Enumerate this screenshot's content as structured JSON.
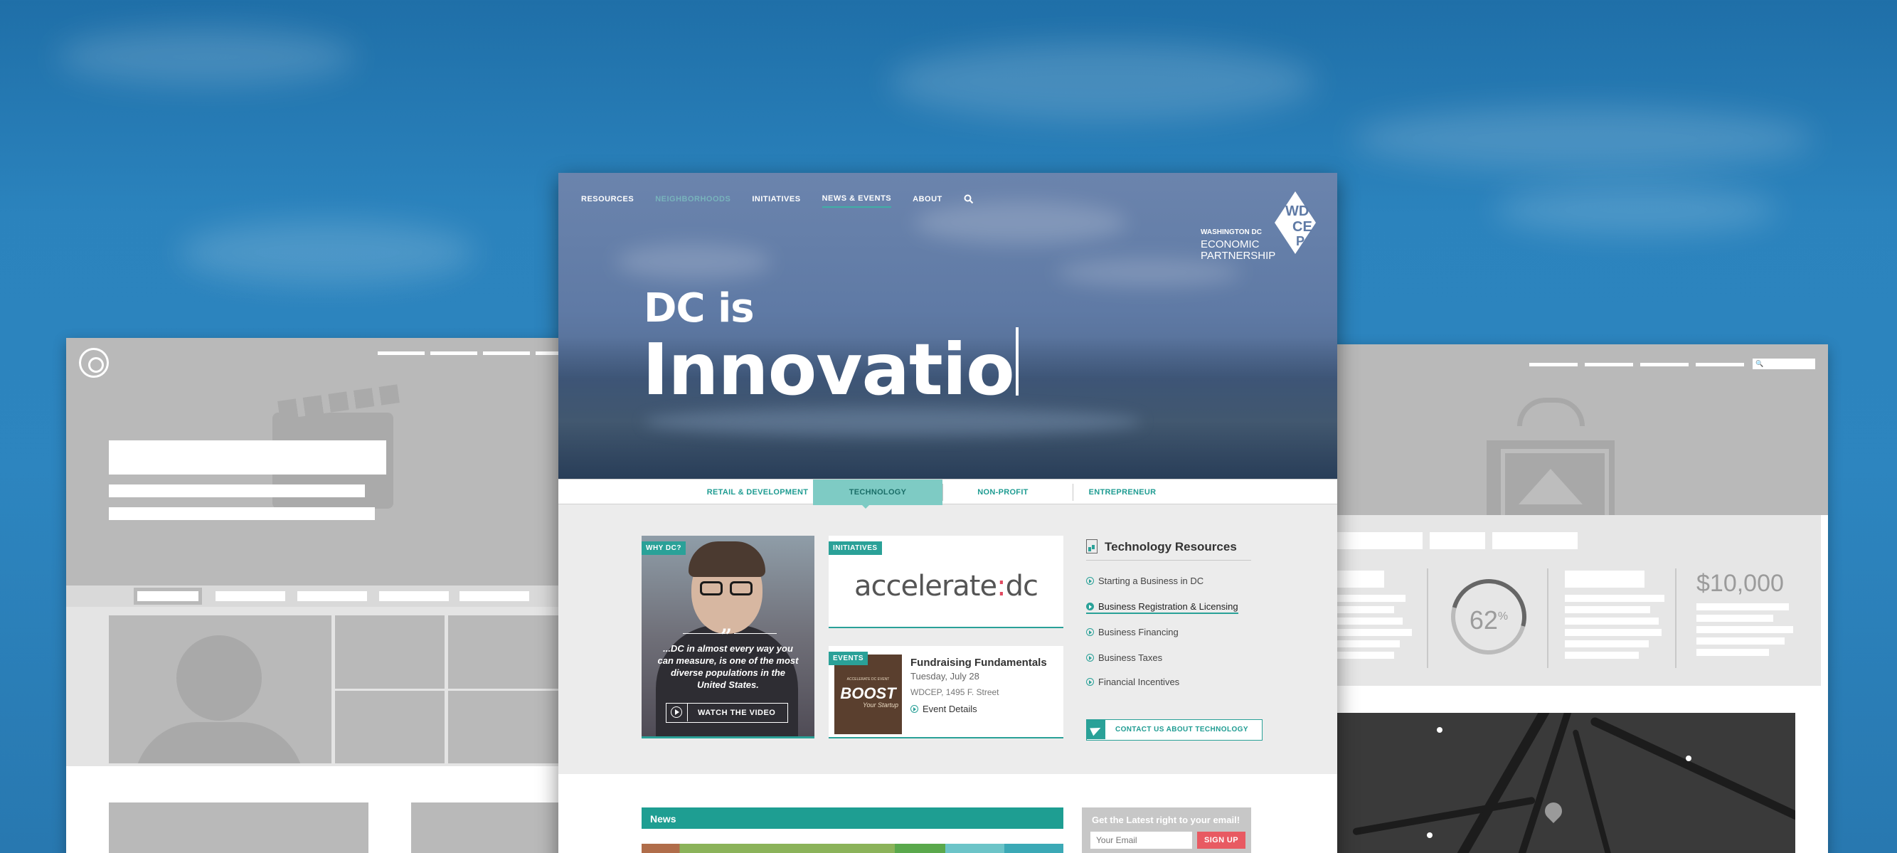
{
  "page": {
    "nav": [
      "RESOURCES",
      "NEIGHBORHOODS",
      "INITIATIVES",
      "NEWS & EVENTS",
      "ABOUT"
    ],
    "logo": {
      "line1": "WASHINGTON DC",
      "line2": "ECONOMIC",
      "line3": "PARTNERSHIP",
      "mark_letters": "WDCEP"
    },
    "hero": {
      "small": "DC is",
      "big": "Innovatio"
    },
    "categories": [
      "RETAIL & DEVELOPMENT",
      "TECHNOLOGY",
      "NON-PROFIT",
      "ENTREPRENEUR"
    ],
    "selected_category": "TECHNOLOGY",
    "why_dc": {
      "badge": "WHY DC?",
      "quote": "...DC in almost every way you can measure, is one of the most diverse populations in the United States.",
      "button": "WATCH THE VIDEO"
    },
    "initiatives": {
      "badge": "INITIATIVES",
      "logo_left": "accelerate",
      "logo_colon": ":",
      "logo_right": "dc"
    },
    "events": {
      "badge": "EVENTS",
      "poster_small": "ACCELERATE DC EVENT",
      "poster_big": "BOOST",
      "poster_sub": "Your Startup",
      "title": "Fundraising Fundamentals",
      "date": "Tuesday, July 28",
      "location": "WDCEP, 1495 F. Street",
      "link": "Event Details"
    },
    "tech": {
      "title": "Technology Resources",
      "items": [
        "Starting a Business in DC",
        "Business Registration & Licensing",
        "Business Financing",
        "Business Taxes",
        "Financial Incentives"
      ],
      "hovered_index": 1,
      "contact": "CONTACT US ABOUT TECHNOLOGY"
    },
    "news": {
      "label": "News"
    },
    "signup": {
      "title": "Get the Latest right to your email!",
      "placeholder": "Your Email",
      "button": "SIGN UP"
    }
  },
  "wireframe_right": {
    "search_glyph": "🔍",
    "ring_value": "62",
    "ring_unit": "%",
    "money": "$10,000"
  },
  "colors": {
    "accent": "#2aa198",
    "signup_button": "#e85a62",
    "accelerate_colon": "#e04a60"
  }
}
